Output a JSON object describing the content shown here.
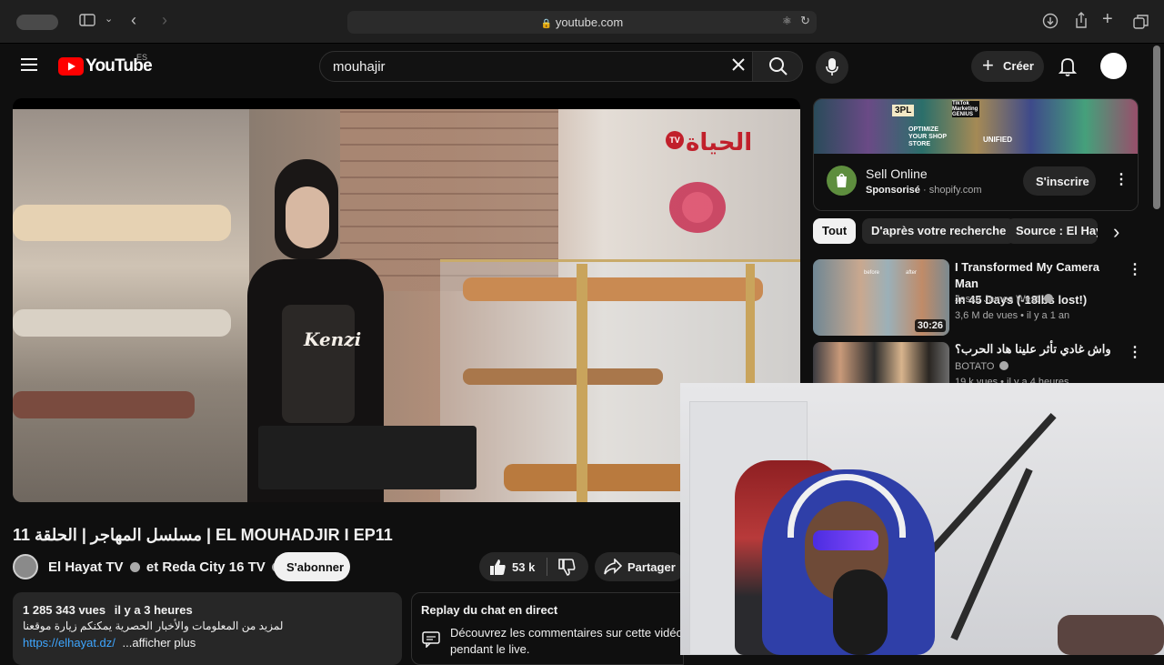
{
  "browser": {
    "url": "youtube.com"
  },
  "header": {
    "logo_text": "YouTube",
    "region": "ES",
    "search_value": "mouhajir",
    "create_label": "Créer"
  },
  "video": {
    "title": "11 مسلسل المهاجر | الحلقة | EL MOUHADJIR I EP11",
    "channel": "El Hayat TV",
    "channel_and": "et Reda City 16 TV",
    "subscribe_label": "S'abonner",
    "likes": "53 k",
    "share_label": "Partager",
    "overlay_logo": "الحياة",
    "overlay_logo_badge": "TV",
    "apron_text": "Kenzi"
  },
  "description": {
    "views": "1 285 343 vues",
    "time": "il y a 3 heures",
    "arabic_line": "لمزيد من المعلومات والأخبار الحصرية يمكنكم زيارة موقعنا",
    "link": "https://elhayat.dz/",
    "more_label": "...afficher plus"
  },
  "chat": {
    "title": "Replay du chat en direct",
    "text_line1": "Découvrez les commentaires sur cette vidéo",
    "text_line2": "pendant le live."
  },
  "ad": {
    "title": "Sell Online",
    "sponsored": "Sponsorisé",
    "domain": "shopify.com",
    "cta": "S'inscrire",
    "banner_words": [
      "3PL",
      "OPTIMIZE YOUR SHOP STORE",
      "UNIFIED",
      "TikTok Marketing GENIUS"
    ]
  },
  "chips": [
    "Tout",
    "D'après votre recherche",
    "Source : El Hayat"
  ],
  "recommendations": [
    {
      "title_line1": "I Transformed My Camera Man",
      "title_line2": "in 45 Days (-18lbs lost!)",
      "channel": "Jesse James West",
      "meta": "3,6 M de vues • il y a 1 an",
      "duration": "30:26",
      "thumb_labels": [
        "before",
        "after"
      ]
    },
    {
      "title_line1": "واش غادي تأثر علينا هاد الحرب؟",
      "channel": "BOTATO",
      "meta": "19 k vues • il y a 4 heures"
    }
  ],
  "colors": {
    "yt_red": "#ff0000",
    "background": "#0f0f0f",
    "chip_selected": "#f1f1f1",
    "shopify_green": "#5e8e3e",
    "hoodie_blue": "#2f3fa8"
  }
}
